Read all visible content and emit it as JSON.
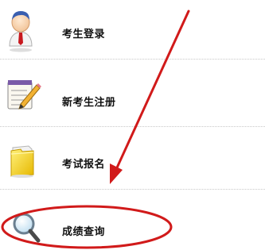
{
  "menu": {
    "items": [
      {
        "label": "考生登录",
        "icon": "user-avatar-icon"
      },
      {
        "label": "新考生注册",
        "icon": "notepad-pencil-icon"
      },
      {
        "label": "考试报名",
        "icon": "folder-icon"
      },
      {
        "label": "成绩查询",
        "icon": "magnifier-icon"
      }
    ]
  },
  "colors": {
    "annotation": "#d11a1a",
    "divider": "#c8c8c8",
    "label": "#111111"
  }
}
